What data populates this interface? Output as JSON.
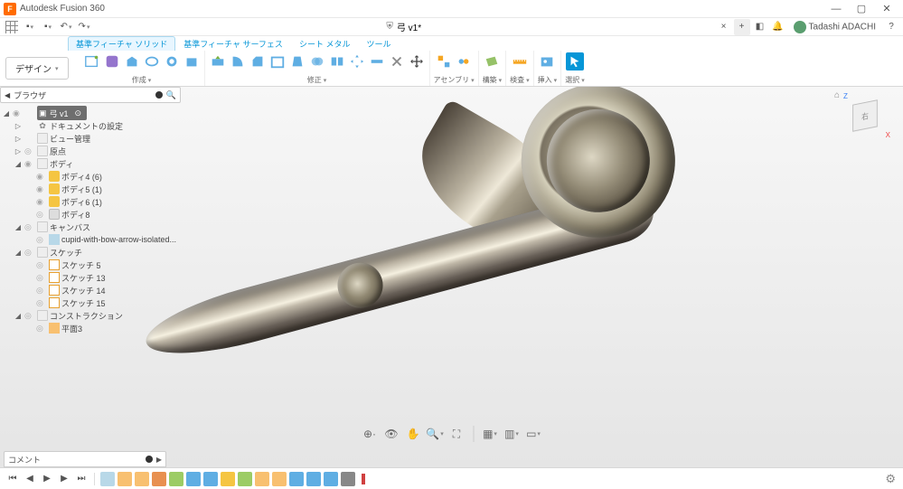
{
  "app": {
    "title": "Autodesk Fusion 360",
    "user": "Tadashi ADACHI"
  },
  "document": {
    "name": "弓 v1*",
    "close_glyph": "×",
    "new_glyph": "+"
  },
  "window": {
    "min": "—",
    "max": "▢",
    "close": "✕"
  },
  "qat": {
    "dropdown": "▾"
  },
  "tabs": {
    "solid": "基準フィーチャ ソリッド",
    "surface": "基準フィーチャ サーフェス",
    "sheetmetal": "シート メタル",
    "tools": "ツール"
  },
  "ribbon": {
    "design": "デザイン",
    "groups": {
      "create": "作成",
      "modify": "修正",
      "assembly": "アセンブリ",
      "construct": "構築",
      "inspect": "検査",
      "insert": "挿入",
      "select": "選択"
    }
  },
  "browser": {
    "title": "ブラウザ",
    "root": "弓 v1",
    "nodes": {
      "doc_settings": "ドキュメントの設定",
      "view_mgmt": "ビュー管理",
      "origin": "原点",
      "bodies": "ボディ",
      "body4": "ボディ4 (6)",
      "body5": "ボディ5 (1)",
      "body6": "ボディ6 (1)",
      "body8": "ボディ8",
      "canvases": "キャンバス",
      "canvas1": "cupid-with-bow-arrow-isolated...",
      "sketches": "スケッチ",
      "sketch5": "スケッチ 5",
      "sketch13": "スケッチ 13",
      "sketch14": "スケッチ 14",
      "sketch15": "スケッチ 15",
      "construction": "コンストラクション",
      "plane3": "平面3"
    }
  },
  "viewcube": {
    "face": "右",
    "z": "Z",
    "x": "X"
  },
  "comments": {
    "label": "コメント"
  },
  "timeline": {
    "play_first": "⏮",
    "play_prev": "◀",
    "play_next": "▶",
    "play_last": "⏭",
    "play": "▶"
  },
  "navbar": {
    "orbit": "⟲",
    "pan": "✥",
    "zoom": "🔍",
    "fit": "⛶",
    "display": "▦",
    "grid": "▦",
    "viewports": "▥"
  }
}
